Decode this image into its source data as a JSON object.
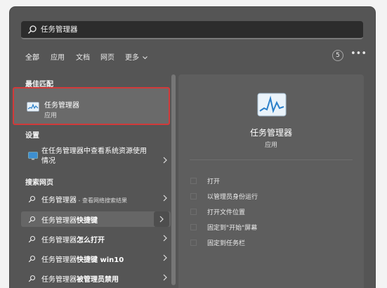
{
  "search": {
    "query": "任务管理器"
  },
  "tabs": [
    {
      "label": "全部",
      "active": true
    },
    {
      "label": "应用"
    },
    {
      "label": "文档"
    },
    {
      "label": "网页"
    },
    {
      "label": "更多"
    }
  ],
  "header": {
    "count_badge": "5",
    "more_icon": "ellipsis-icon"
  },
  "best_match": {
    "section_title": "最佳匹配",
    "name": "任务管理器",
    "type": "应用",
    "icon": "task-manager-icon"
  },
  "settings": {
    "section_title": "设置",
    "item_label": "在任务管理器中查看系统资源使用情况",
    "icon": "monitor-settings-icon"
  },
  "web_search": {
    "section_title": "搜索网页",
    "items": [
      {
        "prefix": "任务管理器",
        "bold": "",
        "suffix": " - 查看网络搜索结果"
      },
      {
        "prefix": "任务管理器",
        "bold": "快捷键",
        "suffix": ""
      },
      {
        "prefix": "任务管理器",
        "bold": "怎么打开",
        "suffix": ""
      },
      {
        "prefix": "任务管理器",
        "bold": "快捷键 win10",
        "suffix": ""
      },
      {
        "prefix": "任务管理器",
        "bold": "被管理员禁用",
        "suffix": ""
      }
    ]
  },
  "detail": {
    "title": "任务管理器",
    "subtitle": "应用",
    "actions": [
      {
        "label": "打开",
        "icon": "open-icon"
      },
      {
        "label": "以管理员身份运行",
        "icon": "run-as-admin-icon"
      },
      {
        "label": "打开文件位置",
        "icon": "folder-icon"
      },
      {
        "label": "固定到\"开始\"屏幕",
        "icon": "pin-start-icon"
      },
      {
        "label": "固定到任务栏",
        "icon": "pin-taskbar-icon"
      }
    ]
  },
  "colors": {
    "panel": "#555555",
    "highlight_border": "#d23a3a",
    "accent_icon": "#4fa3e0"
  }
}
